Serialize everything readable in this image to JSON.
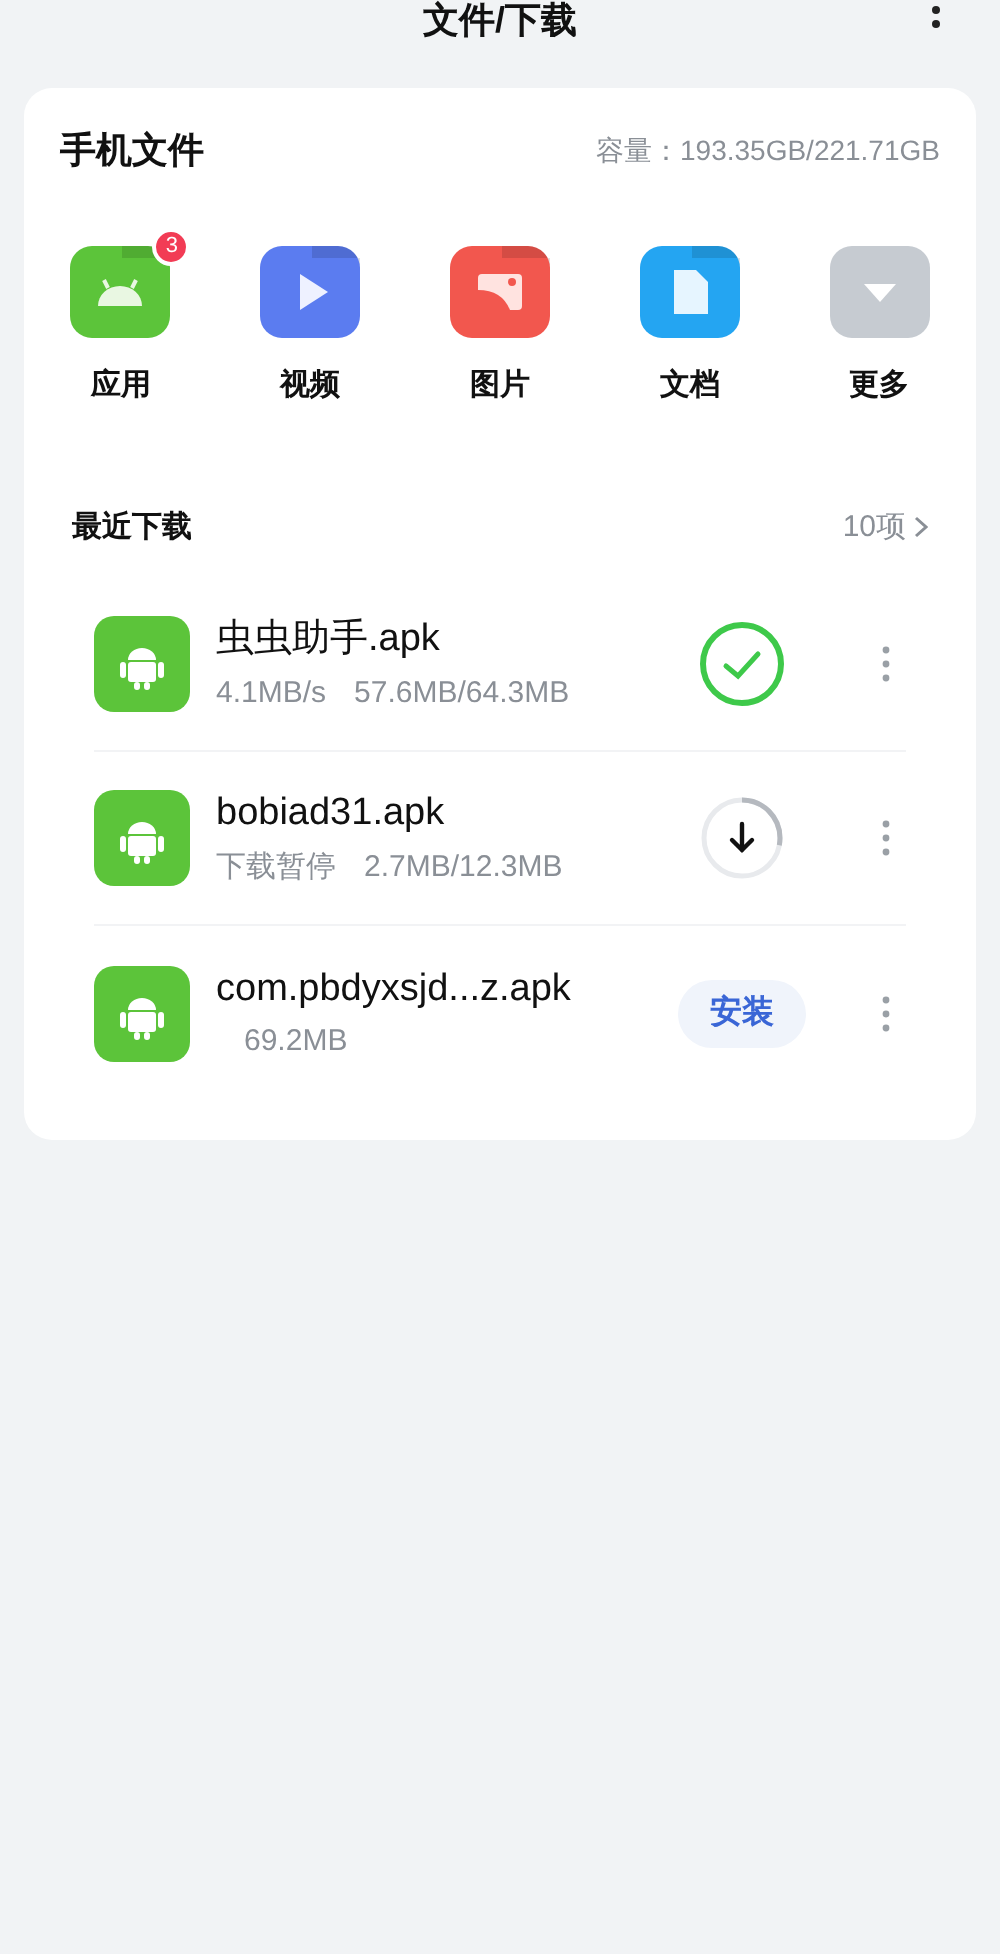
{
  "header": {
    "title": "文件/下载"
  },
  "phone_files": {
    "title": "手机文件",
    "capacity": "容量：193.35GB/221.71GB",
    "categories": [
      {
        "kind": "app",
        "label": "应用",
        "badge": "3"
      },
      {
        "kind": "video",
        "label": "视频"
      },
      {
        "kind": "image",
        "label": "图片"
      },
      {
        "kind": "doc",
        "label": "文档"
      },
      {
        "kind": "more",
        "label": "更多"
      }
    ]
  },
  "recent": {
    "title": "最近下载",
    "count": "10项",
    "items": [
      {
        "name": "虫虫助手.apk",
        "status": "4.1MB/s",
        "size": "57.6MB/64.3MB",
        "kind": "done"
      },
      {
        "name": "bobiad31.apk",
        "status": "下载暂停",
        "size": "2.7MB/12.3MB",
        "kind": "paused"
      },
      {
        "name": "com.pbdyxsjd...z.apk",
        "size": "69.2MB",
        "kind": "install",
        "action": "安装"
      }
    ]
  }
}
